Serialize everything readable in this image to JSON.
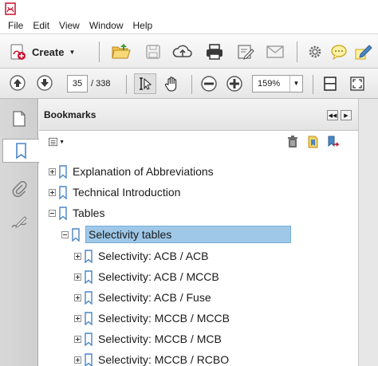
{
  "menubar": {
    "items": [
      "File",
      "Edit",
      "View",
      "Window",
      "Help"
    ]
  },
  "toolbar": {
    "create_label": "Create"
  },
  "navigation": {
    "page_value": "35",
    "page_total": "/ 338",
    "zoom_value": "159%"
  },
  "bookmarks": {
    "title": "Bookmarks",
    "items": [
      {
        "label": "Explanation of Abbreviations",
        "level": 0,
        "expanded": false
      },
      {
        "label": "Technical Introduction",
        "level": 0,
        "expanded": false
      },
      {
        "label": "Tables",
        "level": 0,
        "expanded": true
      },
      {
        "label": "Selectivity tables",
        "level": 1,
        "expanded": true,
        "selected": true
      },
      {
        "label": "Selectivity: ACB / ACB",
        "level": 2,
        "expanded": false
      },
      {
        "label": "Selectivity: ACB / MCCB",
        "level": 2,
        "expanded": false
      },
      {
        "label": "Selectivity: ACB / Fuse",
        "level": 2,
        "expanded": false
      },
      {
        "label": "Selectivity: MCCB / MCCB",
        "level": 2,
        "expanded": false
      },
      {
        "label": "Selectivity: MCCB / MCB",
        "level": 2,
        "expanded": false
      },
      {
        "label": "Selectivity: MCCB / RCBO",
        "level": 2,
        "expanded": false
      }
    ]
  },
  "colors": {
    "selection": "#9fc8e8",
    "accent_red": "#c8102e",
    "ribbon_blue": "#4a86c5"
  }
}
